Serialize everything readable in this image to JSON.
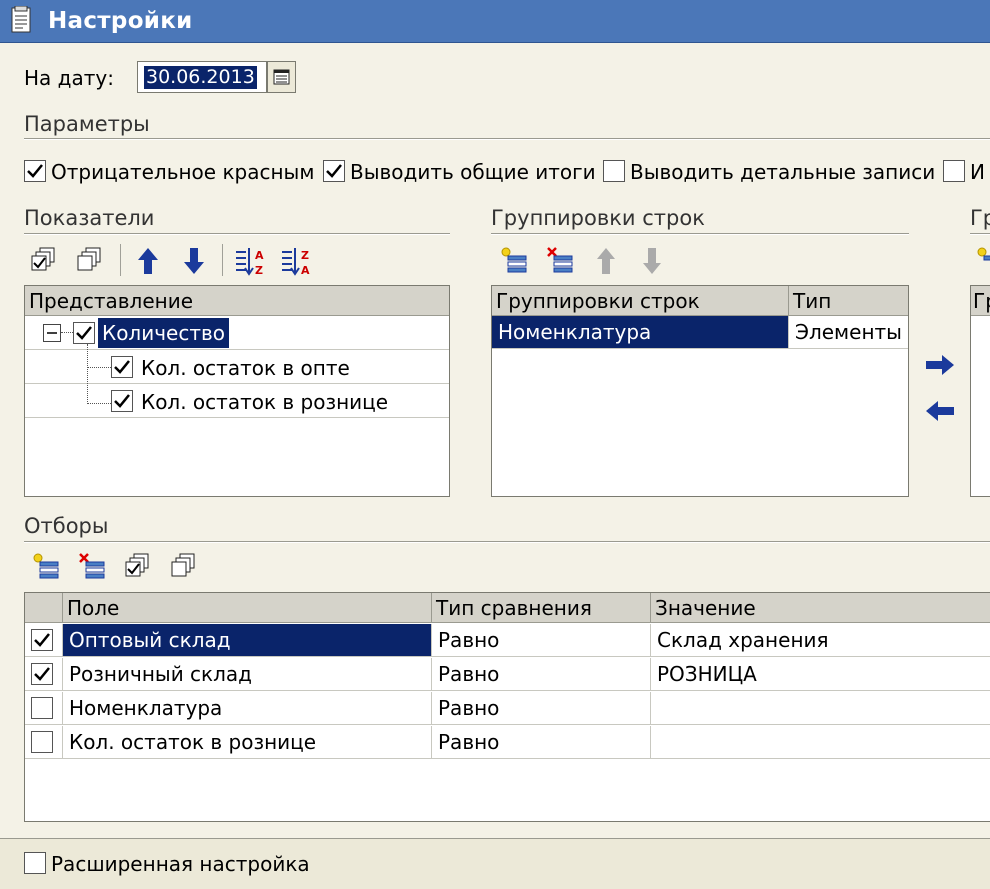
{
  "window": {
    "title": "Настройки"
  },
  "date": {
    "label": "На дату:",
    "value": "30.06.2013"
  },
  "params": {
    "title": "Параметры",
    "options": [
      {
        "label": "Отрицательное красным",
        "checked": true
      },
      {
        "label": "Выводить общие итоги",
        "checked": true
      },
      {
        "label": "Выводить детальные записи",
        "checked": false
      },
      {
        "label": "И",
        "checked": false
      }
    ]
  },
  "indicators": {
    "title": "Показатели",
    "header": "Представление",
    "rows": [
      {
        "label": "Количество",
        "checked": true,
        "selected": true
      },
      {
        "label": "Кол. остаток в опте",
        "checked": true
      },
      {
        "label": "Кол. остаток в рознице",
        "checked": true
      }
    ]
  },
  "grouping": {
    "title": "Группировки строк",
    "columns": [
      "Группировки строк",
      "Тип"
    ],
    "rows": [
      {
        "name": "Номенклатура",
        "type": "Элементы"
      }
    ]
  },
  "grouping_cols": {
    "title": "Гр",
    "header": "Гру"
  },
  "filters": {
    "title": "Отборы",
    "columns": [
      "Поле",
      "Тип сравнения",
      "Значение"
    ],
    "rows": [
      {
        "checked": true,
        "field": "Оптовый склад",
        "compare": "Равно",
        "value": "Склад хранения"
      },
      {
        "checked": true,
        "field": "Розничный склад",
        "compare": "Равно",
        "value": "РОЗНИЦА"
      },
      {
        "checked": false,
        "field": "Номенклатура",
        "compare": "Равно",
        "value": ""
      },
      {
        "checked": false,
        "field": "Кол. остаток в рознице",
        "compare": "Равно",
        "value": ""
      }
    ]
  },
  "advanced": {
    "label": "Расширенная настройка",
    "checked": false
  },
  "colors": {
    "titlebar": "#4b77b8",
    "selection": "#0a246a",
    "window_bg": "#f4f2e7",
    "arrow_blue": "#1b3a9c"
  }
}
